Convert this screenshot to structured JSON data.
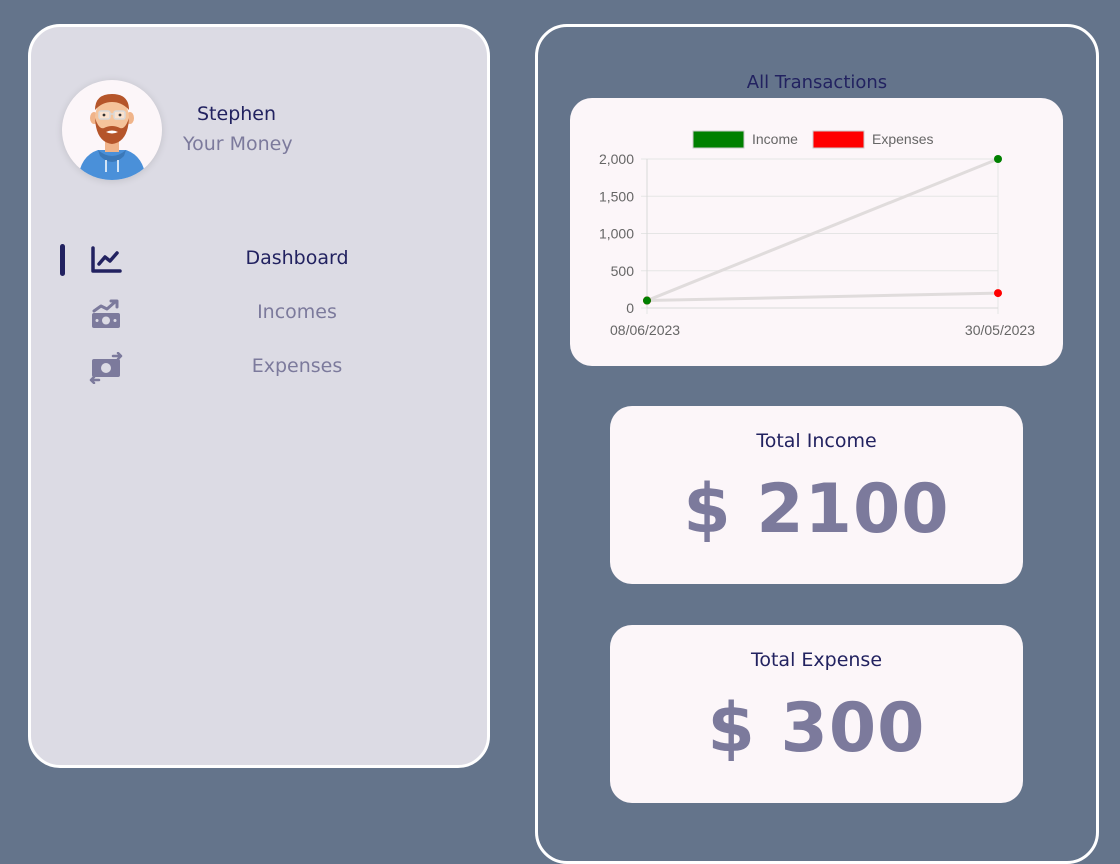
{
  "user": {
    "name": "Stephen",
    "subtitle": "Your Money"
  },
  "nav": {
    "items": [
      {
        "label": "Dashboard",
        "icon": "line-chart-icon",
        "active": true
      },
      {
        "label": "Incomes",
        "icon": "money-bill-trend-icon",
        "active": false
      },
      {
        "label": "Expenses",
        "icon": "money-bill-transfer-icon",
        "active": false
      }
    ]
  },
  "chart": {
    "heading": "All Transactions"
  },
  "chart_data": {
    "type": "line",
    "title": "",
    "xlabel": "",
    "ylabel": "",
    "categories": [
      "08/06/2023",
      "30/05/2023"
    ],
    "ylim": [
      0,
      2000
    ],
    "yticks": [
      "0",
      "500",
      "1,000",
      "1,500",
      "2,000"
    ],
    "grid": true,
    "legend_position": "top",
    "series": [
      {
        "name": "Income",
        "color": "#008000",
        "values": [
          100,
          2000
        ]
      },
      {
        "name": "Expenses",
        "color": "#ff0000",
        "values": [
          100,
          200
        ]
      }
    ]
  },
  "stats": {
    "income_title": "Total Income",
    "income_value": "$ 2100",
    "expense_title": "Total Expense",
    "expense_value": "$ 300"
  },
  "colors": {
    "background": "#64748b",
    "primary": "#222260",
    "muted": "#7c7a9c",
    "card": "#fcf6f9",
    "sidebar": "#dcdbe4"
  }
}
